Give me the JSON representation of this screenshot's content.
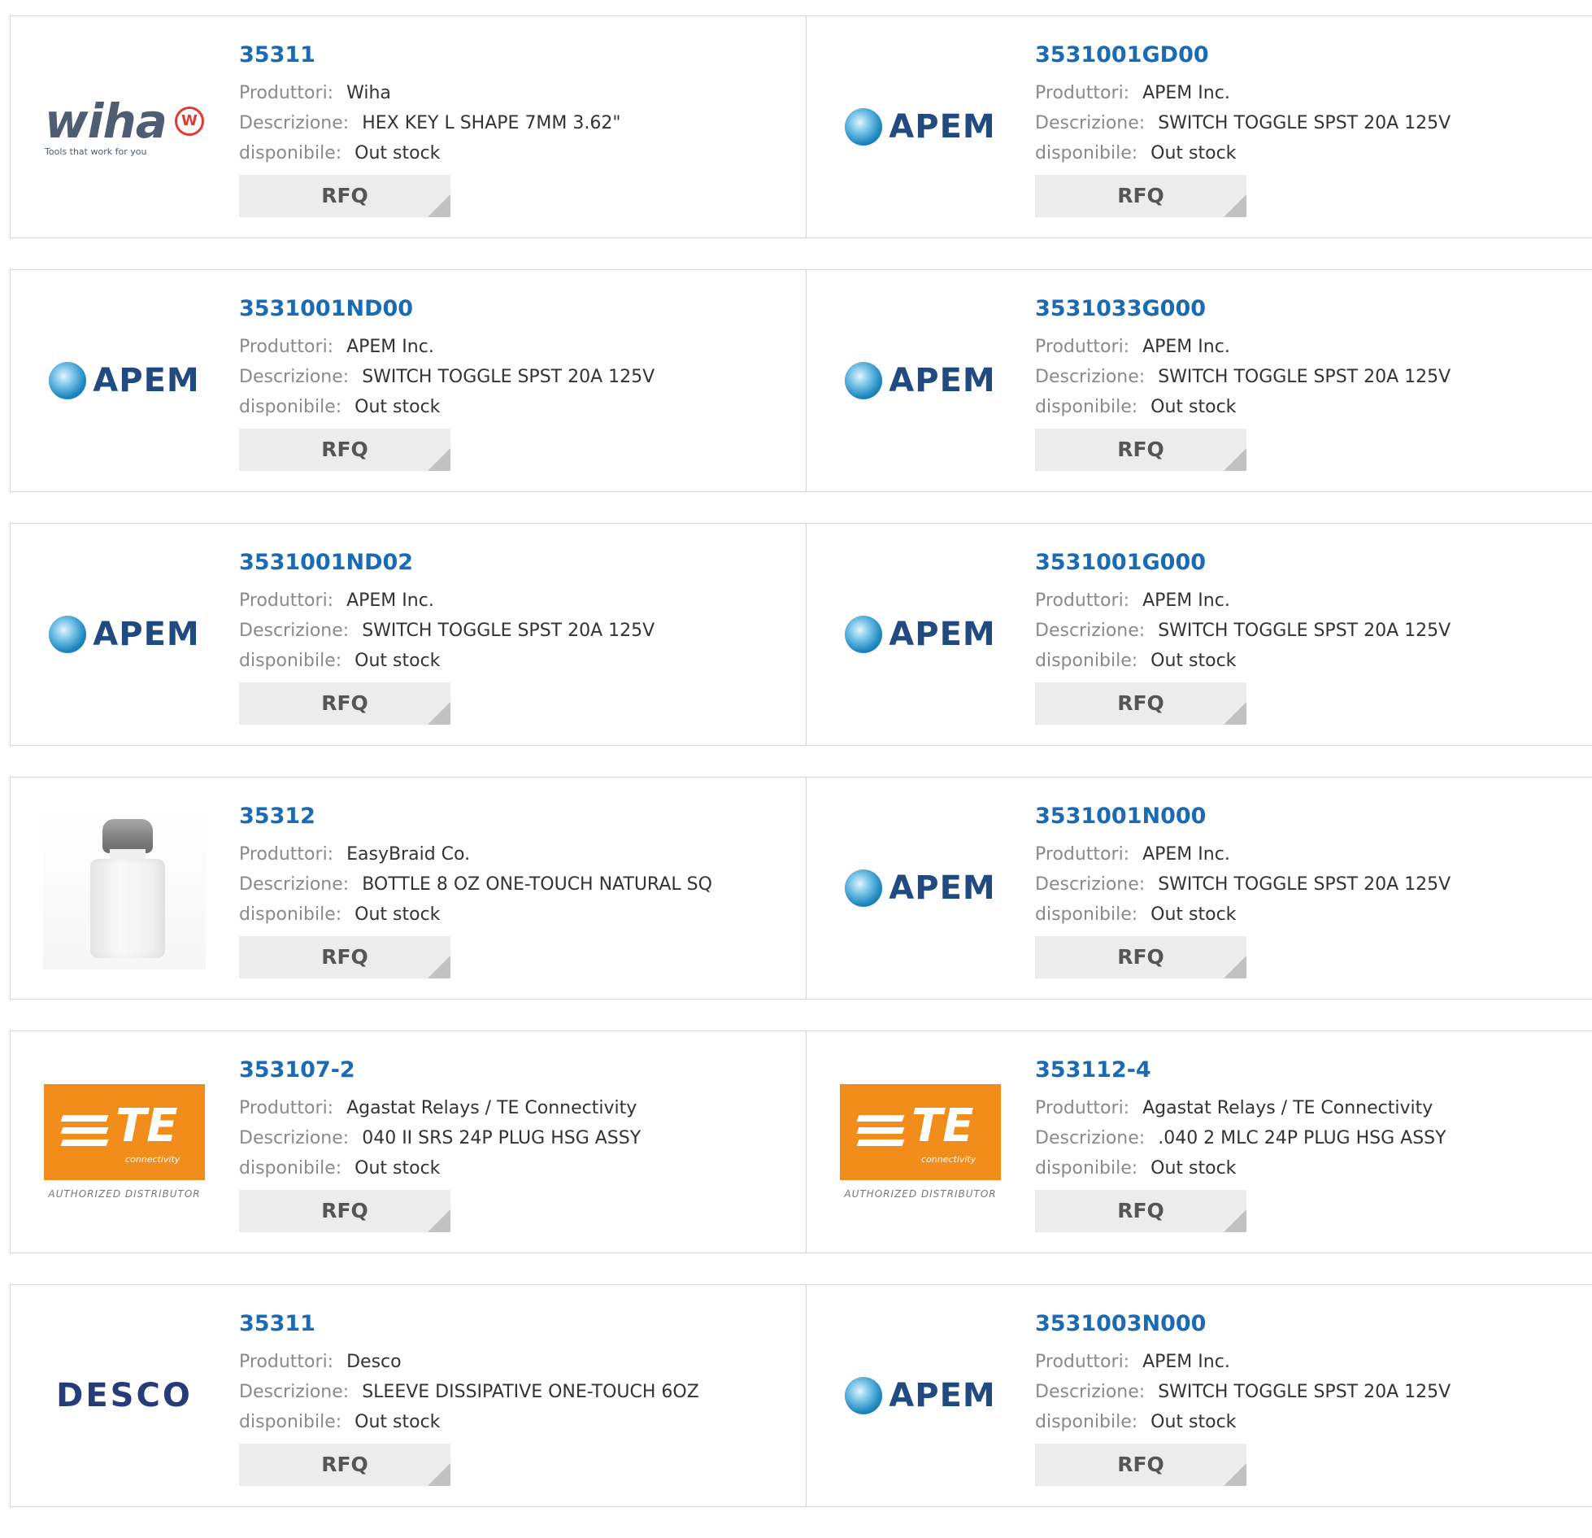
{
  "labels": {
    "manufacturer": "Produttori:",
    "description": "Descrizione:",
    "availability": "disponibile:",
    "rfq": "RFQ"
  },
  "logos": {
    "wiha": {
      "word": "wiha",
      "badge": "W",
      "tagline": "Tools that work for you"
    },
    "apem": {
      "word": "APEM"
    },
    "te": {
      "mark": "TE",
      "sub": "connectivity",
      "authorized": "AUTHORIZED DISTRIBUTOR"
    },
    "desco": {
      "word": "DESCO"
    }
  },
  "colors": {
    "part_link": "#1a6bb5",
    "label": "#8a8a8a",
    "value": "#333333",
    "rfq_bg": "#ececec",
    "border": "#d4d4d4"
  },
  "products": [
    [
      {
        "part": "35311",
        "manufacturer": "Wiha",
        "description": "HEX KEY L SHAPE 7MM 3.62\"",
        "availability": "Out stock",
        "logo": "wiha"
      },
      {
        "part": "3531001GD00",
        "manufacturer": "APEM Inc.",
        "description": "SWITCH TOGGLE SPST 20A 125V",
        "availability": "Out stock",
        "logo": "apem"
      }
    ],
    [
      {
        "part": "3531001ND00",
        "manufacturer": "APEM Inc.",
        "description": "SWITCH TOGGLE SPST 20A 125V",
        "availability": "Out stock",
        "logo": "apem"
      },
      {
        "part": "3531033G000",
        "manufacturer": "APEM Inc.",
        "description": "SWITCH TOGGLE SPST 20A 125V",
        "availability": "Out stock",
        "logo": "apem"
      }
    ],
    [
      {
        "part": "3531001ND02",
        "manufacturer": "APEM Inc.",
        "description": "SWITCH TOGGLE SPST 20A 125V",
        "availability": "Out stock",
        "logo": "apem"
      },
      {
        "part": "3531001G000",
        "manufacturer": "APEM Inc.",
        "description": "SWITCH TOGGLE SPST 20A 125V",
        "availability": "Out stock",
        "logo": "apem"
      }
    ],
    [
      {
        "part": "35312",
        "manufacturer": "EasyBraid Co.",
        "description": "BOTTLE 8 OZ ONE-TOUCH NATURAL SQ",
        "availability": "Out stock",
        "logo": "bottle"
      },
      {
        "part": "3531001N000",
        "manufacturer": "APEM Inc.",
        "description": "SWITCH TOGGLE SPST 20A 125V",
        "availability": "Out stock",
        "logo": "apem"
      }
    ],
    [
      {
        "part": "353107-2",
        "manufacturer": "Agastat Relays / TE Connectivity",
        "description": "040 II SRS 24P PLUG HSG ASSY",
        "availability": "Out stock",
        "logo": "te"
      },
      {
        "part": "353112-4",
        "manufacturer": "Agastat Relays / TE Connectivity",
        "description": ".040 2 MLC 24P PLUG HSG ASSY",
        "availability": "Out stock",
        "logo": "te"
      }
    ],
    [
      {
        "part": "35311",
        "manufacturer": "Desco",
        "description": "SLEEVE DISSIPATIVE ONE-TOUCH 6OZ",
        "availability": "Out stock",
        "logo": "desco"
      },
      {
        "part": "3531003N000",
        "manufacturer": "APEM Inc.",
        "description": "SWITCH TOGGLE SPST 20A 125V",
        "availability": "Out stock",
        "logo": "apem"
      }
    ]
  ]
}
